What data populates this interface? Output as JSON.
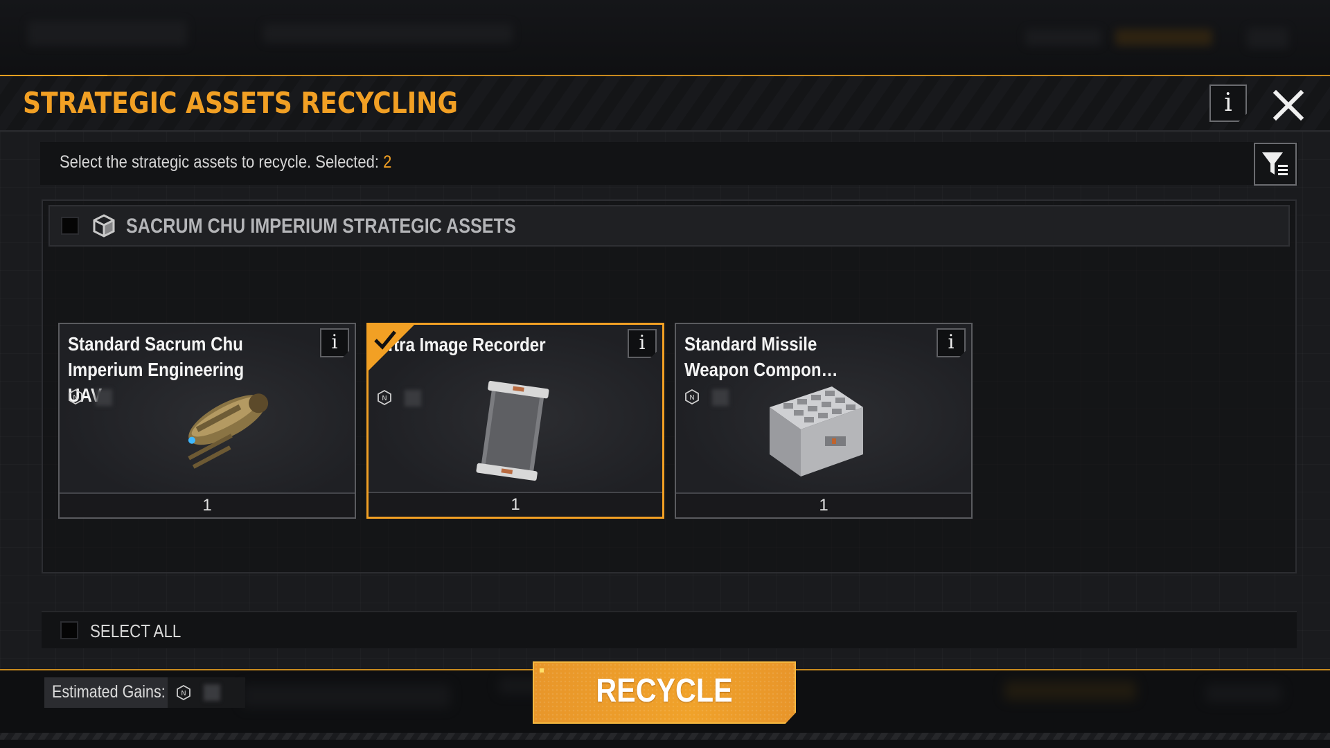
{
  "dialog": {
    "title": "STRATEGIC ASSETS RECYCLING",
    "info_label": "i"
  },
  "subheader": {
    "text": "Select the strategic assets to recycle. Selected:",
    "selected_count": "2"
  },
  "group": {
    "title": "SACRUM CHU IMPERIUM STRATEGIC ASSETS"
  },
  "items": [
    {
      "name": "Standard Sacrum Chu Imperium Engineering UAV",
      "count": "1",
      "selected": false,
      "icon": "uav-drone-icon"
    },
    {
      "name": "…tra Image Recorder",
      "count": "1",
      "selected": true,
      "icon": "image-recorder-icon"
    },
    {
      "name": "Standard Missile Weapon Compon…",
      "count": "1",
      "selected": false,
      "icon": "missile-component-crate-icon"
    }
  ],
  "select_all": {
    "label": "SELECT ALL"
  },
  "gains": {
    "label": "Estimated Gains:"
  },
  "actions": {
    "recycle_label": "RECYCLE"
  },
  "colors": {
    "accent": "#f2a024",
    "button": "#ec9a2a"
  }
}
